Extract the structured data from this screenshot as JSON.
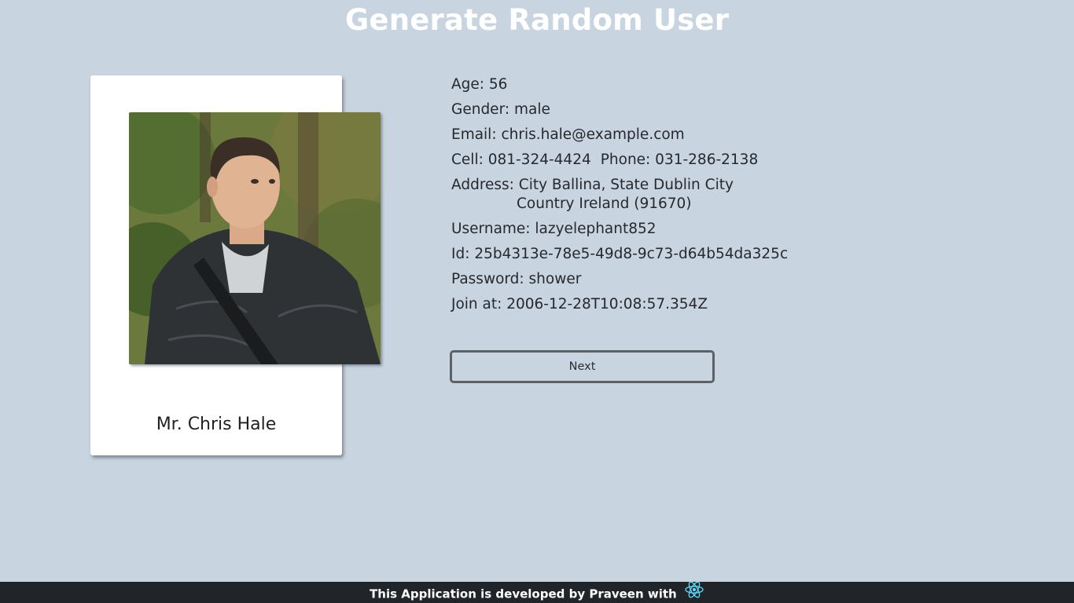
{
  "header": {
    "title": "Generate Random User"
  },
  "card": {
    "name": "Mr. Chris Hale",
    "photo_icon": "user-photo"
  },
  "details": {
    "age": "Age: 56",
    "gender": "Gender: male",
    "email": "Email: chris.hale@example.com",
    "cell": "Cell: 081-324-4424",
    "phone": "Phone: 031-286-2138",
    "address_line1": "Address: City Ballina, State Dublin City",
    "address_line2": "Country Ireland (91670)",
    "username": "Username: lazyelephant852",
    "id": "Id: 25b4313e-78e5-49d8-9c73-d64b54da325c",
    "password": "Password: shower",
    "joined": "Join at: 2006-12-28T10:08:57.354Z"
  },
  "actions": {
    "next_label": "Next"
  },
  "footer": {
    "text": "This Application is developed by Praveen with",
    "icon": "react-icon",
    "icon_color": "#61dafb"
  }
}
